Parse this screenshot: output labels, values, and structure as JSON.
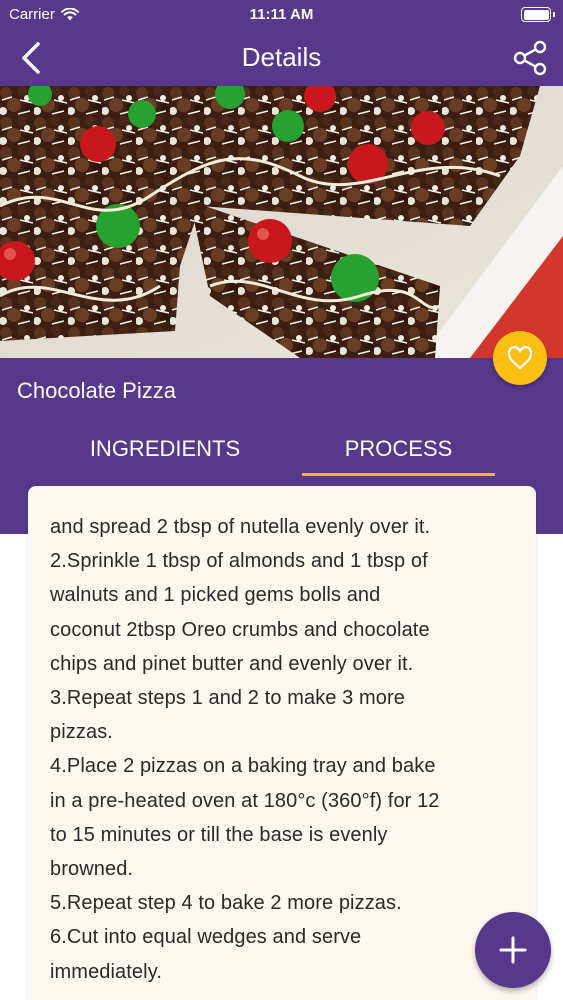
{
  "status_bar": {
    "carrier": "Carrier",
    "time": "11:11 AM"
  },
  "nav": {
    "title": "Details",
    "back_icon": "chevron-left-icon",
    "share_icon": "share-icon"
  },
  "recipe": {
    "name": "Chocolate Pizza",
    "favorite_icon": "heart-icon"
  },
  "tabs": [
    {
      "label": "INGREDIENTS",
      "active": false
    },
    {
      "label": "PROCESS",
      "active": true
    }
  ],
  "process_lines": [
    "and spread 2 tbsp of nutella evenly over it.",
    "2.Sprinkle 1 tbsp of almonds and 1 tbsp of",
    "walnuts and 1 picked gems bolls and",
    "coconut 2tbsp Oreo crumbs and chocolate",
    "chips and pinet butter and evenly over it.",
    "3.Repeat steps 1 and 2 to make 3 more",
    "pizzas.",
    "4.Place 2 pizzas on a baking tray and bake",
    "in a pre-heated oven at 180°c (360°f) for 12",
    "to 15 minutes or till the base is evenly",
    "browned.",
    "5.Repeat step 4 to bake 2 more pizzas.",
    "6.Cut into equal wedges and serve",
    "immediately."
  ],
  "fab_icon": "plus-icon",
  "colors": {
    "primary": "#57388a",
    "accent": "#f9bf14",
    "card": "#fdf9f1"
  }
}
